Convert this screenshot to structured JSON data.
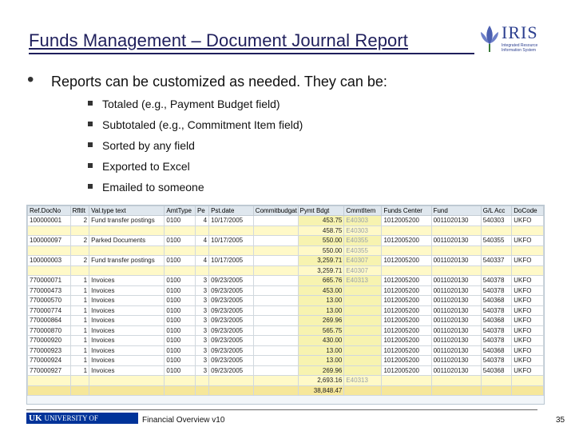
{
  "title": "Funds Management – Document Journal Report",
  "logo": {
    "name": "IRIS",
    "sub": "Integrated Resource Information System"
  },
  "main_bullet": "Reports can be customized as needed. They can be:",
  "sub_bullets": [
    "Totaled (e.g., Payment Budget field)",
    "Subtotaled (e.g., Commitment Item field)",
    "Sorted by any field",
    "Exported to Excel",
    "Emailed to someone"
  ],
  "grid": {
    "headers": [
      "Ref.DocNo",
      "RfltIt",
      "Val.type text",
      "AmtType",
      "Pe",
      "Pst.date",
      "Commitbudgat",
      "Pymt Bdgt",
      "CmmtItem",
      "Funds Center",
      "Fund",
      "G/L Acc",
      "DoCode"
    ],
    "rows": [
      {
        "type": "data",
        "cells": [
          "100000001",
          "2",
          "Fund transfer postings",
          "0100",
          "4",
          "10/17/2005",
          "",
          "453.75",
          "E40303",
          "1012005200",
          "0011020130",
          "540303",
          "UKFO"
        ]
      },
      {
        "type": "sub",
        "cells": [
          "",
          "",
          "",
          "",
          "",
          "",
          "",
          "458.75",
          "E40303",
          "",
          "",
          "",
          ""
        ]
      },
      {
        "type": "data",
        "cells": [
          "100000097",
          "2",
          "Parked Documents",
          "0100",
          "4",
          "10/17/2005",
          "",
          "550.00",
          "E40355",
          "1012005200",
          "0011020130",
          "540355",
          "UKFO"
        ]
      },
      {
        "type": "sub",
        "cells": [
          "",
          "",
          "",
          "",
          "",
          "",
          "",
          "550.00",
          "E40355",
          "",
          "",
          "",
          ""
        ]
      },
      {
        "type": "data",
        "cells": [
          "100000003",
          "2",
          "Fund transfer postings",
          "0100",
          "4",
          "10/17/2005",
          "",
          "3,259.71",
          "E40307",
          "1012005200",
          "0011020130",
          "540337",
          "UKFO"
        ]
      },
      {
        "type": "sub",
        "cells": [
          "",
          "",
          "",
          "",
          "",
          "",
          "",
          "3,259.71",
          "E40307",
          "",
          "",
          "",
          ""
        ]
      },
      {
        "type": "data",
        "cells": [
          "770000071",
          "1",
          "Invoices",
          "0100",
          "3",
          "09/23/2005",
          "",
          "665.76",
          "E40313",
          "1012005200",
          "0011020130",
          "540378",
          "UKFO"
        ]
      },
      {
        "type": "data",
        "cells": [
          "770000473",
          "1",
          "Invoices",
          "0100",
          "3",
          "09/23/2005",
          "",
          "453.00",
          "",
          "1012005200",
          "0011020130",
          "540378",
          "UKFO"
        ]
      },
      {
        "type": "data",
        "cells": [
          "770000570",
          "1",
          "Invoices",
          "0100",
          "3",
          "09/23/2005",
          "",
          "13.00",
          "",
          "1012005200",
          "0011020130",
          "540368",
          "UKFO"
        ]
      },
      {
        "type": "data",
        "cells": [
          "770000774",
          "1",
          "Invoices",
          "0100",
          "3",
          "09/23/2005",
          "",
          "13.00",
          "",
          "1012005200",
          "0011020130",
          "540378",
          "UKFO"
        ]
      },
      {
        "type": "data",
        "cells": [
          "770000864",
          "1",
          "Invoices",
          "0100",
          "3",
          "09/23/2005",
          "",
          "269.96",
          "",
          "1012005200",
          "0011020130",
          "540368",
          "UKFO"
        ]
      },
      {
        "type": "data",
        "cells": [
          "770000870",
          "1",
          "Invoices",
          "0100",
          "3",
          "09/23/2005",
          "",
          "565.75",
          "",
          "1012005200",
          "0011020130",
          "540378",
          "UKFO"
        ]
      },
      {
        "type": "data",
        "cells": [
          "770000920",
          "1",
          "Invoices",
          "0100",
          "3",
          "09/23/2005",
          "",
          "430.00",
          "",
          "1012005200",
          "0011020130",
          "540378",
          "UKFO"
        ]
      },
      {
        "type": "data",
        "cells": [
          "770000923",
          "1",
          "Invoices",
          "0100",
          "3",
          "09/23/2005",
          "",
          "13.00",
          "",
          "1012005200",
          "0011020130",
          "540368",
          "UKFO"
        ]
      },
      {
        "type": "data",
        "cells": [
          "770000924",
          "1",
          "Invoices",
          "0100",
          "3",
          "09/23/2005",
          "",
          "13.00",
          "",
          "1012005200",
          "0011020130",
          "540378",
          "UKFO"
        ]
      },
      {
        "type": "data",
        "cells": [
          "770000927",
          "1",
          "Invoices",
          "0100",
          "3",
          "09/23/2005",
          "",
          "269.96",
          "",
          "1012005200",
          "0011020130",
          "540368",
          "UKFO"
        ]
      },
      {
        "type": "sub",
        "cells": [
          "",
          "",
          "",
          "",
          "",
          "",
          "",
          "2,693.16",
          "E40313",
          "",
          "",
          "",
          ""
        ]
      },
      {
        "type": "total",
        "cells": [
          "",
          "",
          "",
          "",
          "",
          "",
          "",
          "38,848.47",
          "",
          "",
          "",
          "",
          ""
        ]
      }
    ]
  },
  "footer": {
    "university": "UNIVERSITY OF KENTUCKY",
    "uk": "UK",
    "text": "Financial Overview v10",
    "page": "35"
  }
}
